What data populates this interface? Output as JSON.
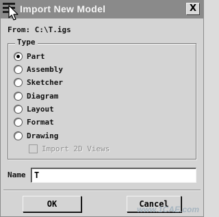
{
  "window": {
    "title": "Import New Model",
    "close_glyph": "X",
    "menu_icon": "hamburger-menu-icon",
    "cursor_icon": "mouse-pointer-icon"
  },
  "source": {
    "from_label": "From: C:\\T.igs"
  },
  "type_group": {
    "legend": "Type",
    "options": [
      {
        "label": "Part",
        "selected": true
      },
      {
        "label": "Assembly",
        "selected": false
      },
      {
        "label": "Sketcher",
        "selected": false
      },
      {
        "label": "Diagram",
        "selected": false
      },
      {
        "label": "Layout",
        "selected": false
      },
      {
        "label": "Format",
        "selected": false
      },
      {
        "label": "Drawing",
        "selected": false
      }
    ],
    "import_2d_views": {
      "label": "Import 2D Views",
      "checked": false,
      "enabled": false
    }
  },
  "name_field": {
    "label": "Name",
    "value": "T"
  },
  "buttons": {
    "ok": "OK",
    "cancel": "Cancel"
  },
  "watermark": "www.1CAE.com",
  "colors": {
    "titlebar": "#8a8a8a",
    "dialog_bg": "#d4d4d4",
    "disabled_text": "#8f8f8f"
  }
}
